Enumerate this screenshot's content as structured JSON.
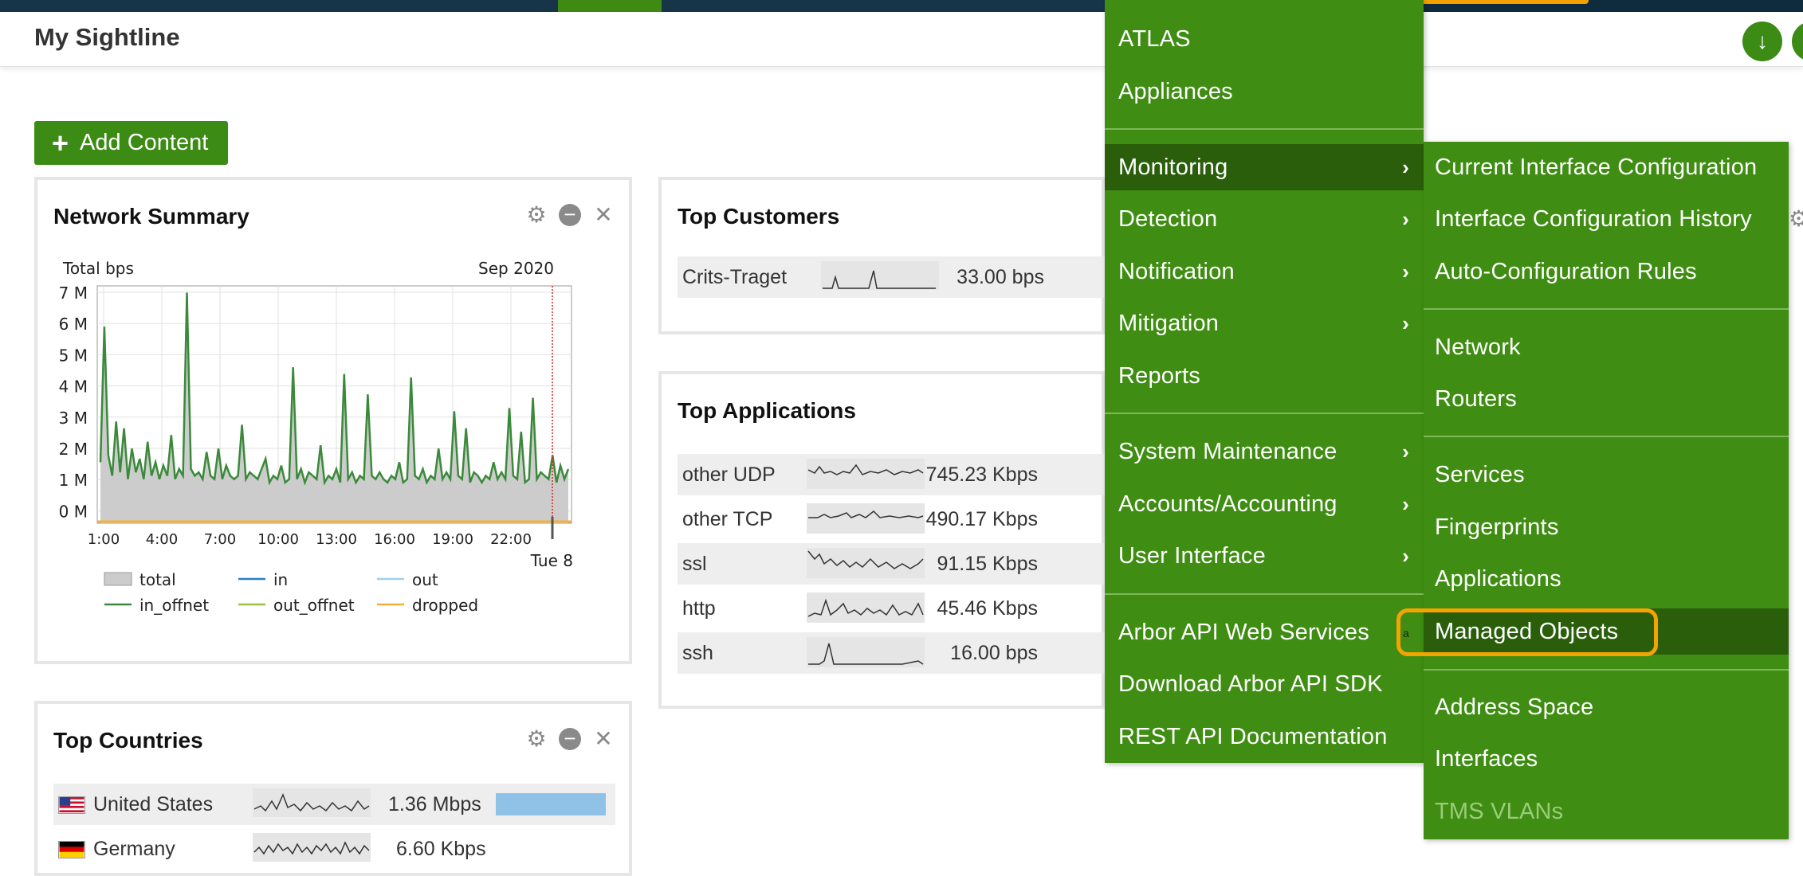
{
  "header": {
    "title": "My Sightline"
  },
  "add_content": {
    "label": "Add Content",
    "icon": "plus-icon"
  },
  "network_summary": {
    "title": "Network Summary",
    "chart_data": {
      "type": "area",
      "title": "Total bps",
      "date_label": "Sep 2020",
      "ylabel": "Total bps",
      "y_ticks": [
        "7 M",
        "6 M",
        "5 M",
        "4 M",
        "3 M",
        "2 M",
        "1 M",
        "0 M"
      ],
      "x_ticks": [
        "1:00",
        "4:00",
        "7:00",
        "10:00",
        "13:00",
        "16:00",
        "19:00",
        "22:00"
      ],
      "x_end_label": "Tue 8",
      "ylim": [
        0,
        7000000
      ],
      "legend": [
        "total",
        "in",
        "out",
        "in_offnet",
        "out_offnet",
        "dropped"
      ],
      "legend_colors": {
        "total": "#cccccc",
        "in": "#2a7fbf",
        "out": "#9fd0ec",
        "in_offnet": "#3a8a3a",
        "out_offnet": "#9cc04a",
        "dropped": "#f3b03a"
      },
      "series": [
        {
          "name": "in_offnet",
          "values": [
            1800000,
            5800000,
            2000000,
            1400000,
            3000000,
            1500000,
            2800000,
            1300000,
            2200000,
            1500000,
            1900000,
            1300000,
            2400000,
            1400000,
            1800000,
            1300000,
            1700000,
            1400000,
            2600000,
            1300000,
            1600000,
            1400000,
            6800000,
            1600000,
            1400000,
            1500000,
            1300000,
            2100000,
            1400000,
            1300000,
            2200000,
            1300000,
            1700000,
            1400000,
            1300000,
            1400000,
            2900000,
            1300000,
            1500000,
            1400000,
            1300000,
            1600000,
            1900000,
            1200000,
            1400000,
            1300000,
            1700000,
            1200000,
            1300000,
            4600000,
            1300000,
            1600000,
            1200000,
            1500000,
            1400000,
            1300000,
            2300000,
            1200000,
            1400000,
            1300000,
            1600000,
            1200000,
            4400000,
            1300000,
            1500000,
            1200000,
            1400000,
            1300000,
            3800000,
            1400000,
            1300000,
            1500000,
            1300000,
            1200000,
            1400000,
            1300000,
            1800000,
            1200000,
            1300000,
            4300000,
            1400000,
            1300000,
            1600000,
            1200000,
            1400000,
            1300000,
            2200000,
            1300000,
            1500000,
            1300000,
            3300000,
            1400000,
            1300000,
            2800000,
            1200000,
            1500000,
            1400000,
            1200000,
            1400000,
            1300000,
            1800000,
            1300000,
            1500000,
            1300000,
            3400000,
            1400000,
            1300000,
            2700000,
            1200000,
            1300000,
            3700000,
            1300000,
            1500000,
            1400000,
            1300000,
            2000000,
            1200000,
            1700000,
            1300000,
            1600000
          ],
          "color": "#3a8a3a"
        }
      ]
    }
  },
  "top_customers": {
    "title": "Top Customers",
    "rows": [
      {
        "name": "Crits-Traget",
        "value": "33.00 bps"
      }
    ]
  },
  "top_applications": {
    "title": "Top Applications",
    "rows": [
      {
        "name": "other UDP",
        "value": "745.23 Kbps"
      },
      {
        "name": "other TCP",
        "value": "490.17 Kbps"
      },
      {
        "name": "ssl",
        "value": "91.15 Kbps"
      },
      {
        "name": "http",
        "value": "45.46 Kbps"
      },
      {
        "name": "ssh",
        "value": "16.00 bps"
      }
    ]
  },
  "top_countries": {
    "title": "Top Countries",
    "rows": [
      {
        "name": "United States",
        "value": "1.36 Mbps",
        "flag": "us-flag-icon"
      },
      {
        "name": "Germany",
        "value": "6.60 Kbps",
        "flag": "de-flag-icon"
      }
    ]
  },
  "main_menu": {
    "items": [
      {
        "label": "ATLAS"
      },
      {
        "label": "Appliances"
      },
      {
        "label": "Monitoring",
        "submenu": true,
        "active": true
      },
      {
        "label": "Detection",
        "submenu": true
      },
      {
        "label": "Notification",
        "submenu": true
      },
      {
        "label": "Mitigation",
        "submenu": true
      },
      {
        "label": "Reports"
      },
      {
        "label": "System Maintenance",
        "submenu": true
      },
      {
        "label": "Accounts/Accounting",
        "submenu": true
      },
      {
        "label": "User Interface",
        "submenu": true
      },
      {
        "label": "Arbor API Web Services"
      },
      {
        "label": "Download Arbor API SDK"
      },
      {
        "label": "REST API Documentation"
      }
    ]
  },
  "monitoring_submenu": {
    "items": [
      {
        "label": "Current Interface Configuration"
      },
      {
        "label": "Interface Configuration History"
      },
      {
        "label": "Auto-Configuration Rules"
      },
      {
        "label": "Network"
      },
      {
        "label": "Routers"
      },
      {
        "label": "Services"
      },
      {
        "label": "Fingerprints"
      },
      {
        "label": "Applications"
      },
      {
        "label": "Managed Objects",
        "active": true
      },
      {
        "label": "Address Space"
      },
      {
        "label": "Interfaces"
      },
      {
        "label": "TMS VLANs",
        "disabled": true
      }
    ],
    "focus_hint": "a"
  },
  "colors": {
    "brand_green": "#3f8d12",
    "active_green": "#2a5e0b",
    "highlight": "#f5a300",
    "navy": "#173549"
  }
}
